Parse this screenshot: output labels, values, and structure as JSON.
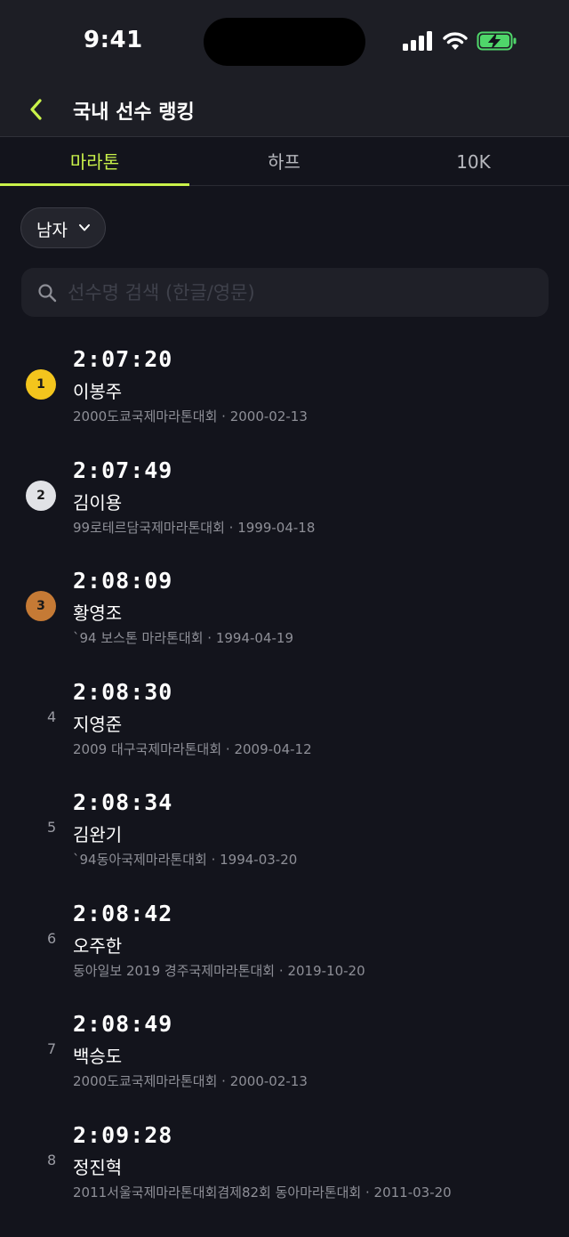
{
  "status_bar": {
    "time": "9:41"
  },
  "header": {
    "title": "국내 선수 랭킹"
  },
  "tabs": [
    {
      "label": "마라톤",
      "active": true
    },
    {
      "label": "하프",
      "active": false
    },
    {
      "label": "10K",
      "active": false
    }
  ],
  "filter": {
    "gender": "남자"
  },
  "search": {
    "placeholder": "선수명 검색 (한글/영문)",
    "value": ""
  },
  "colors": {
    "accent": "#c9f24a",
    "gold": "#f3c51d",
    "silver": "#e1e2e6",
    "bronze": "#c57a35",
    "background": "#13141c"
  },
  "records": [
    {
      "rank": "1",
      "time": "2:07:20",
      "name": "이봉주",
      "race": "2000도쿄국제마라톤대회",
      "date": "2000-02-13"
    },
    {
      "rank": "2",
      "time": "2:07:49",
      "name": "김이용",
      "race": "99로테르담국제마라톤대회",
      "date": "1999-04-18"
    },
    {
      "rank": "3",
      "time": "2:08:09",
      "name": "황영조",
      "race": "`94 보스톤 마라톤대회",
      "date": "1994-04-19"
    },
    {
      "rank": "4",
      "time": "2:08:30",
      "name": "지영준",
      "race": "2009 대구국제마라톤대회",
      "date": "2009-04-12"
    },
    {
      "rank": "5",
      "time": "2:08:34",
      "name": "김완기",
      "race": "`94동아국제마라톤대회",
      "date": "1994-03-20"
    },
    {
      "rank": "6",
      "time": "2:08:42",
      "name": "오주한",
      "race": "동아일보 2019 경주국제마라톤대회",
      "date": "2019-10-20"
    },
    {
      "rank": "7",
      "time": "2:08:49",
      "name": "백승도",
      "race": "2000도쿄국제마라톤대회",
      "date": "2000-02-13"
    },
    {
      "rank": "8",
      "time": "2:09:28",
      "name": "정진혁",
      "race": "2011서울국제마라톤대회겸제82회 동아마라톤대회",
      "date": "2011-03-20"
    }
  ],
  "meta_separator": " · "
}
